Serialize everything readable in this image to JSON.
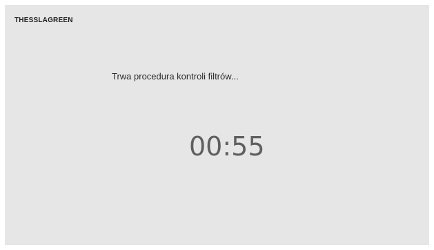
{
  "header": {
    "brand": "THESSLAGREEN"
  },
  "status": {
    "message": "Trwa procedura kontroli filtrów..."
  },
  "countdown": {
    "time": "00:55"
  }
}
